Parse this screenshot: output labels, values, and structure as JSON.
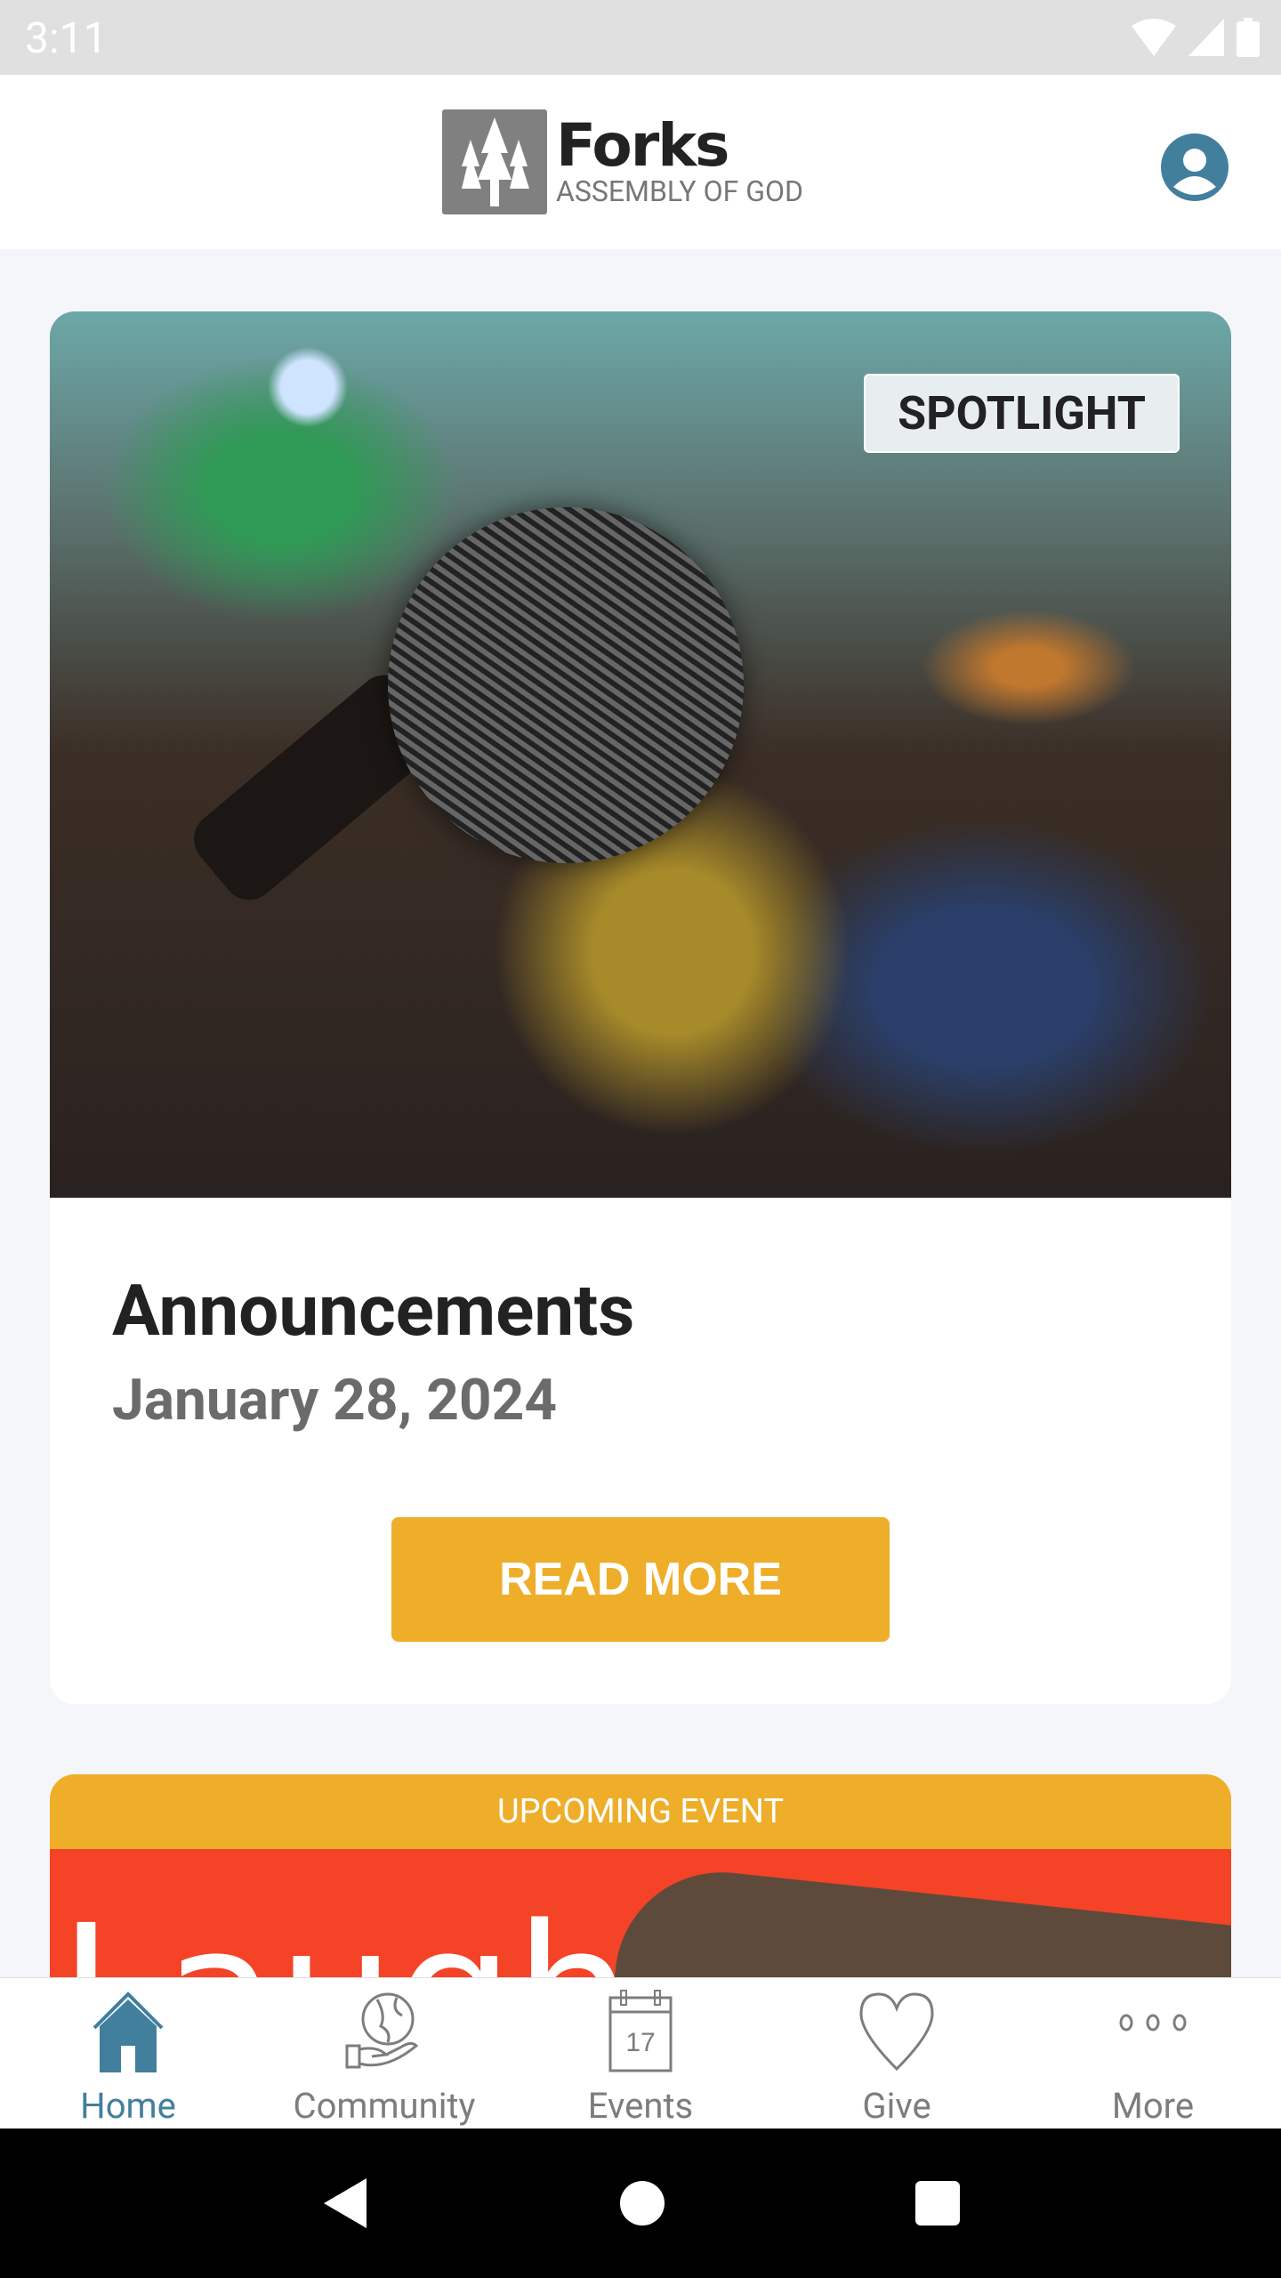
{
  "status_bar": {
    "time": "3:11"
  },
  "header": {
    "logo_title": "Forks",
    "logo_subtitle": "ASSEMBLY OF GOD"
  },
  "spotlight": {
    "badge": "SPOTLIGHT",
    "title": "Announcements",
    "date": "January 28, 2024",
    "button": "READ MORE"
  },
  "event": {
    "band": "UPCOMING EVENT",
    "image_text": "Laugh"
  },
  "nav": {
    "items": [
      {
        "label": "Home",
        "icon": "home-icon",
        "active": true
      },
      {
        "label": "Community",
        "icon": "globe-hand-icon"
      },
      {
        "label": "Events",
        "icon": "calendar-icon",
        "day": "17"
      },
      {
        "label": "Give",
        "icon": "heart-icon"
      },
      {
        "label": "More",
        "icon": "more-icon"
      }
    ]
  },
  "colors": {
    "accent": "#427f9c",
    "brand_yellow": "#eeae2a",
    "event_red": "#f44327"
  }
}
